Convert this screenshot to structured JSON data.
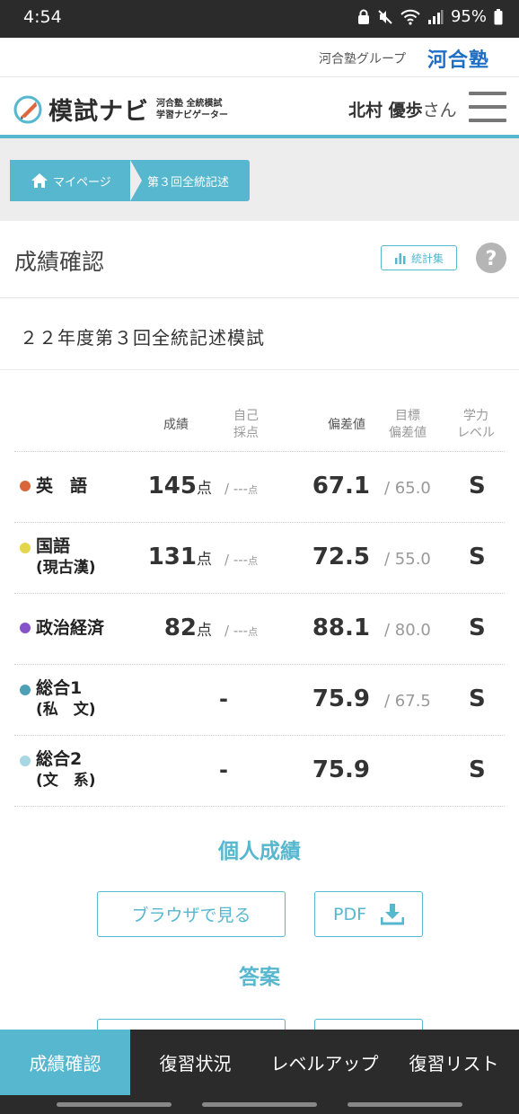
{
  "status_bar": {
    "time": "4:54",
    "battery": "95%",
    "icons": [
      "lock-app-icon",
      "mute-icon",
      "wifi-icon",
      "signal-icon",
      "battery-icon"
    ]
  },
  "group_header": {
    "group_text": "河合塾グループ",
    "logo_text": "河合塾"
  },
  "app_header": {
    "logo_text": "模試ナビ",
    "logo_sub_line1": "河合塾 全統模試",
    "logo_sub_line2": "学習ナビゲーター",
    "user_name": "北村 優歩",
    "user_suffix": "さん",
    "menu_icon": "hamburger-menu-icon"
  },
  "breadcrumb": {
    "home_label": "マイページ",
    "current_label": "第３回全統記述"
  },
  "page": {
    "title": "成績確認",
    "stats_button_label": "統計集"
  },
  "exam_name": "２２年度第３回全統記述模試",
  "table": {
    "headers": {
      "score": "成績",
      "self_line1": "自己",
      "self_line2": "採点",
      "deviation": "偏差値",
      "target_line1": "目標",
      "target_line2": "偏差値",
      "level_line1": "学力",
      "level_line2": "レベル"
    },
    "rows": [
      {
        "subject": "英　語",
        "subject_sub": "",
        "score": "145",
        "unit": "点",
        "self_score": "/ ---",
        "self_unit": "点",
        "deviation": "67.1",
        "target": "/ 65.0",
        "level": "S",
        "color": "#d9653b"
      },
      {
        "subject": "国語",
        "subject_sub": "(現古漢)",
        "score": "131",
        "unit": "点",
        "self_score": "/ ---",
        "self_unit": "点",
        "deviation": "72.5",
        "target": "/ 55.0",
        "level": "S",
        "color": "#e4d64a"
      },
      {
        "subject": "政治経済",
        "subject_sub": "",
        "score": "82",
        "unit": "点",
        "self_score": "/ ---",
        "self_unit": "点",
        "deviation": "88.1",
        "target": "/ 80.0",
        "level": "S",
        "color": "#8753c9"
      },
      {
        "subject": "総合1",
        "subject_sub": "(私　文)",
        "score": "-",
        "unit": "",
        "self_score": "",
        "self_unit": "",
        "deviation": "75.9",
        "target": "/ 67.5",
        "level": "S",
        "color": "#4c9fb5"
      },
      {
        "subject": "総合2",
        "subject_sub": "(文　系)",
        "score": "-",
        "unit": "",
        "self_score": "",
        "self_unit": "",
        "deviation": "75.9",
        "target": "",
        "level": "S",
        "color": "#a7d7e2"
      }
    ]
  },
  "individual_section": {
    "title": "個人成績",
    "browser_button": "ブラウザで見る",
    "pdf_button": "PDF"
  },
  "answer_section": {
    "title": "答案"
  },
  "bottom_nav": {
    "items": [
      "成績確認",
      "復習状況",
      "レベルアップ",
      "復習リスト"
    ]
  },
  "colors": {
    "accent": "#56b7cf",
    "dark_bar": "#2b2b2b"
  }
}
